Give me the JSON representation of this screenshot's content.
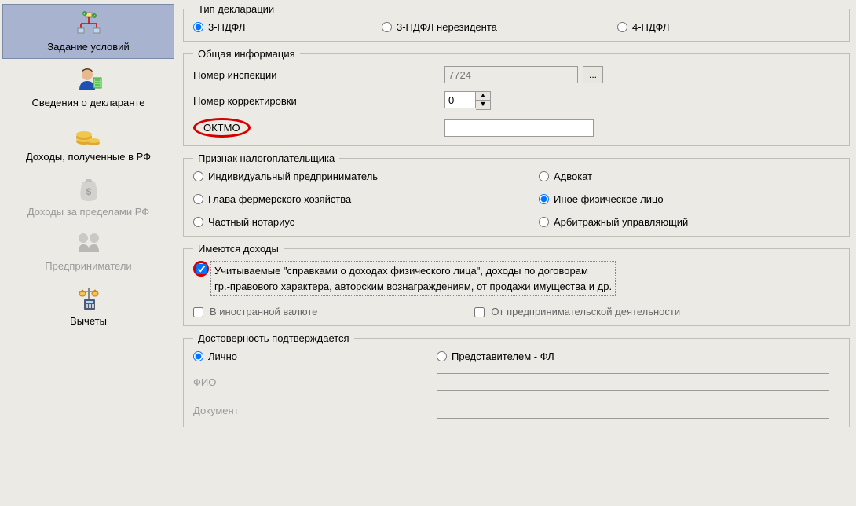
{
  "nav": {
    "items": [
      {
        "label": "Задание условий",
        "selected": true,
        "disabled": false
      },
      {
        "label": "Сведения о декларанте",
        "selected": false,
        "disabled": false
      },
      {
        "label": "Доходы, полученные в РФ",
        "selected": false,
        "disabled": false
      },
      {
        "label": "Доходы за пределами РФ",
        "selected": false,
        "disabled": true
      },
      {
        "label": "Предприниматели",
        "selected": false,
        "disabled": true
      },
      {
        "label": "Вычеты",
        "selected": false,
        "disabled": false
      }
    ]
  },
  "decl_type": {
    "legend": "Тип декларации",
    "options": [
      {
        "label": "3-НДФЛ",
        "checked": true
      },
      {
        "label": "3-НДФЛ нерезидента",
        "checked": false
      },
      {
        "label": "4-НДФЛ",
        "checked": false
      }
    ]
  },
  "general": {
    "legend": "Общая информация",
    "inspection_label": "Номер инспекции",
    "inspection_value": "7724",
    "browse_btn": "...",
    "correction_label": "Номер корректировки",
    "correction_value": "0",
    "oktmo_label": "ОКТМО",
    "oktmo_value": ""
  },
  "taxpayer": {
    "legend": "Признак налогоплательщика",
    "options": [
      {
        "label": "Индивидуальный предприниматель",
        "checked": false
      },
      {
        "label": "Адвокат",
        "checked": false
      },
      {
        "label": "Глава фермерского хозяйства",
        "checked": false
      },
      {
        "label": "Иное физическое лицо",
        "checked": true
      },
      {
        "label": "Частный нотариус",
        "checked": false
      },
      {
        "label": "Арбитражный управляющий",
        "checked": false
      }
    ]
  },
  "income": {
    "legend": "Имеются доходы",
    "main_line1": "Учитываемые \"справками о доходах физического лица\", доходы по договорам",
    "main_line2": "гр.-правового характера, авторским вознаграждениям, от продажи имущества и др.",
    "main_checked": true,
    "foreign_label": "В иностранной валюте",
    "foreign_checked": false,
    "entrepreneur_label": "От предпринимательской деятельности",
    "entrepreneur_checked": false
  },
  "trust": {
    "legend": "Достоверность подтверждается",
    "options": [
      {
        "label": "Лично",
        "checked": true
      },
      {
        "label": "Представителем - ФЛ",
        "checked": false
      }
    ],
    "fio_label": "ФИО",
    "fio_value": "",
    "doc_label": "Документ",
    "doc_value": ""
  }
}
